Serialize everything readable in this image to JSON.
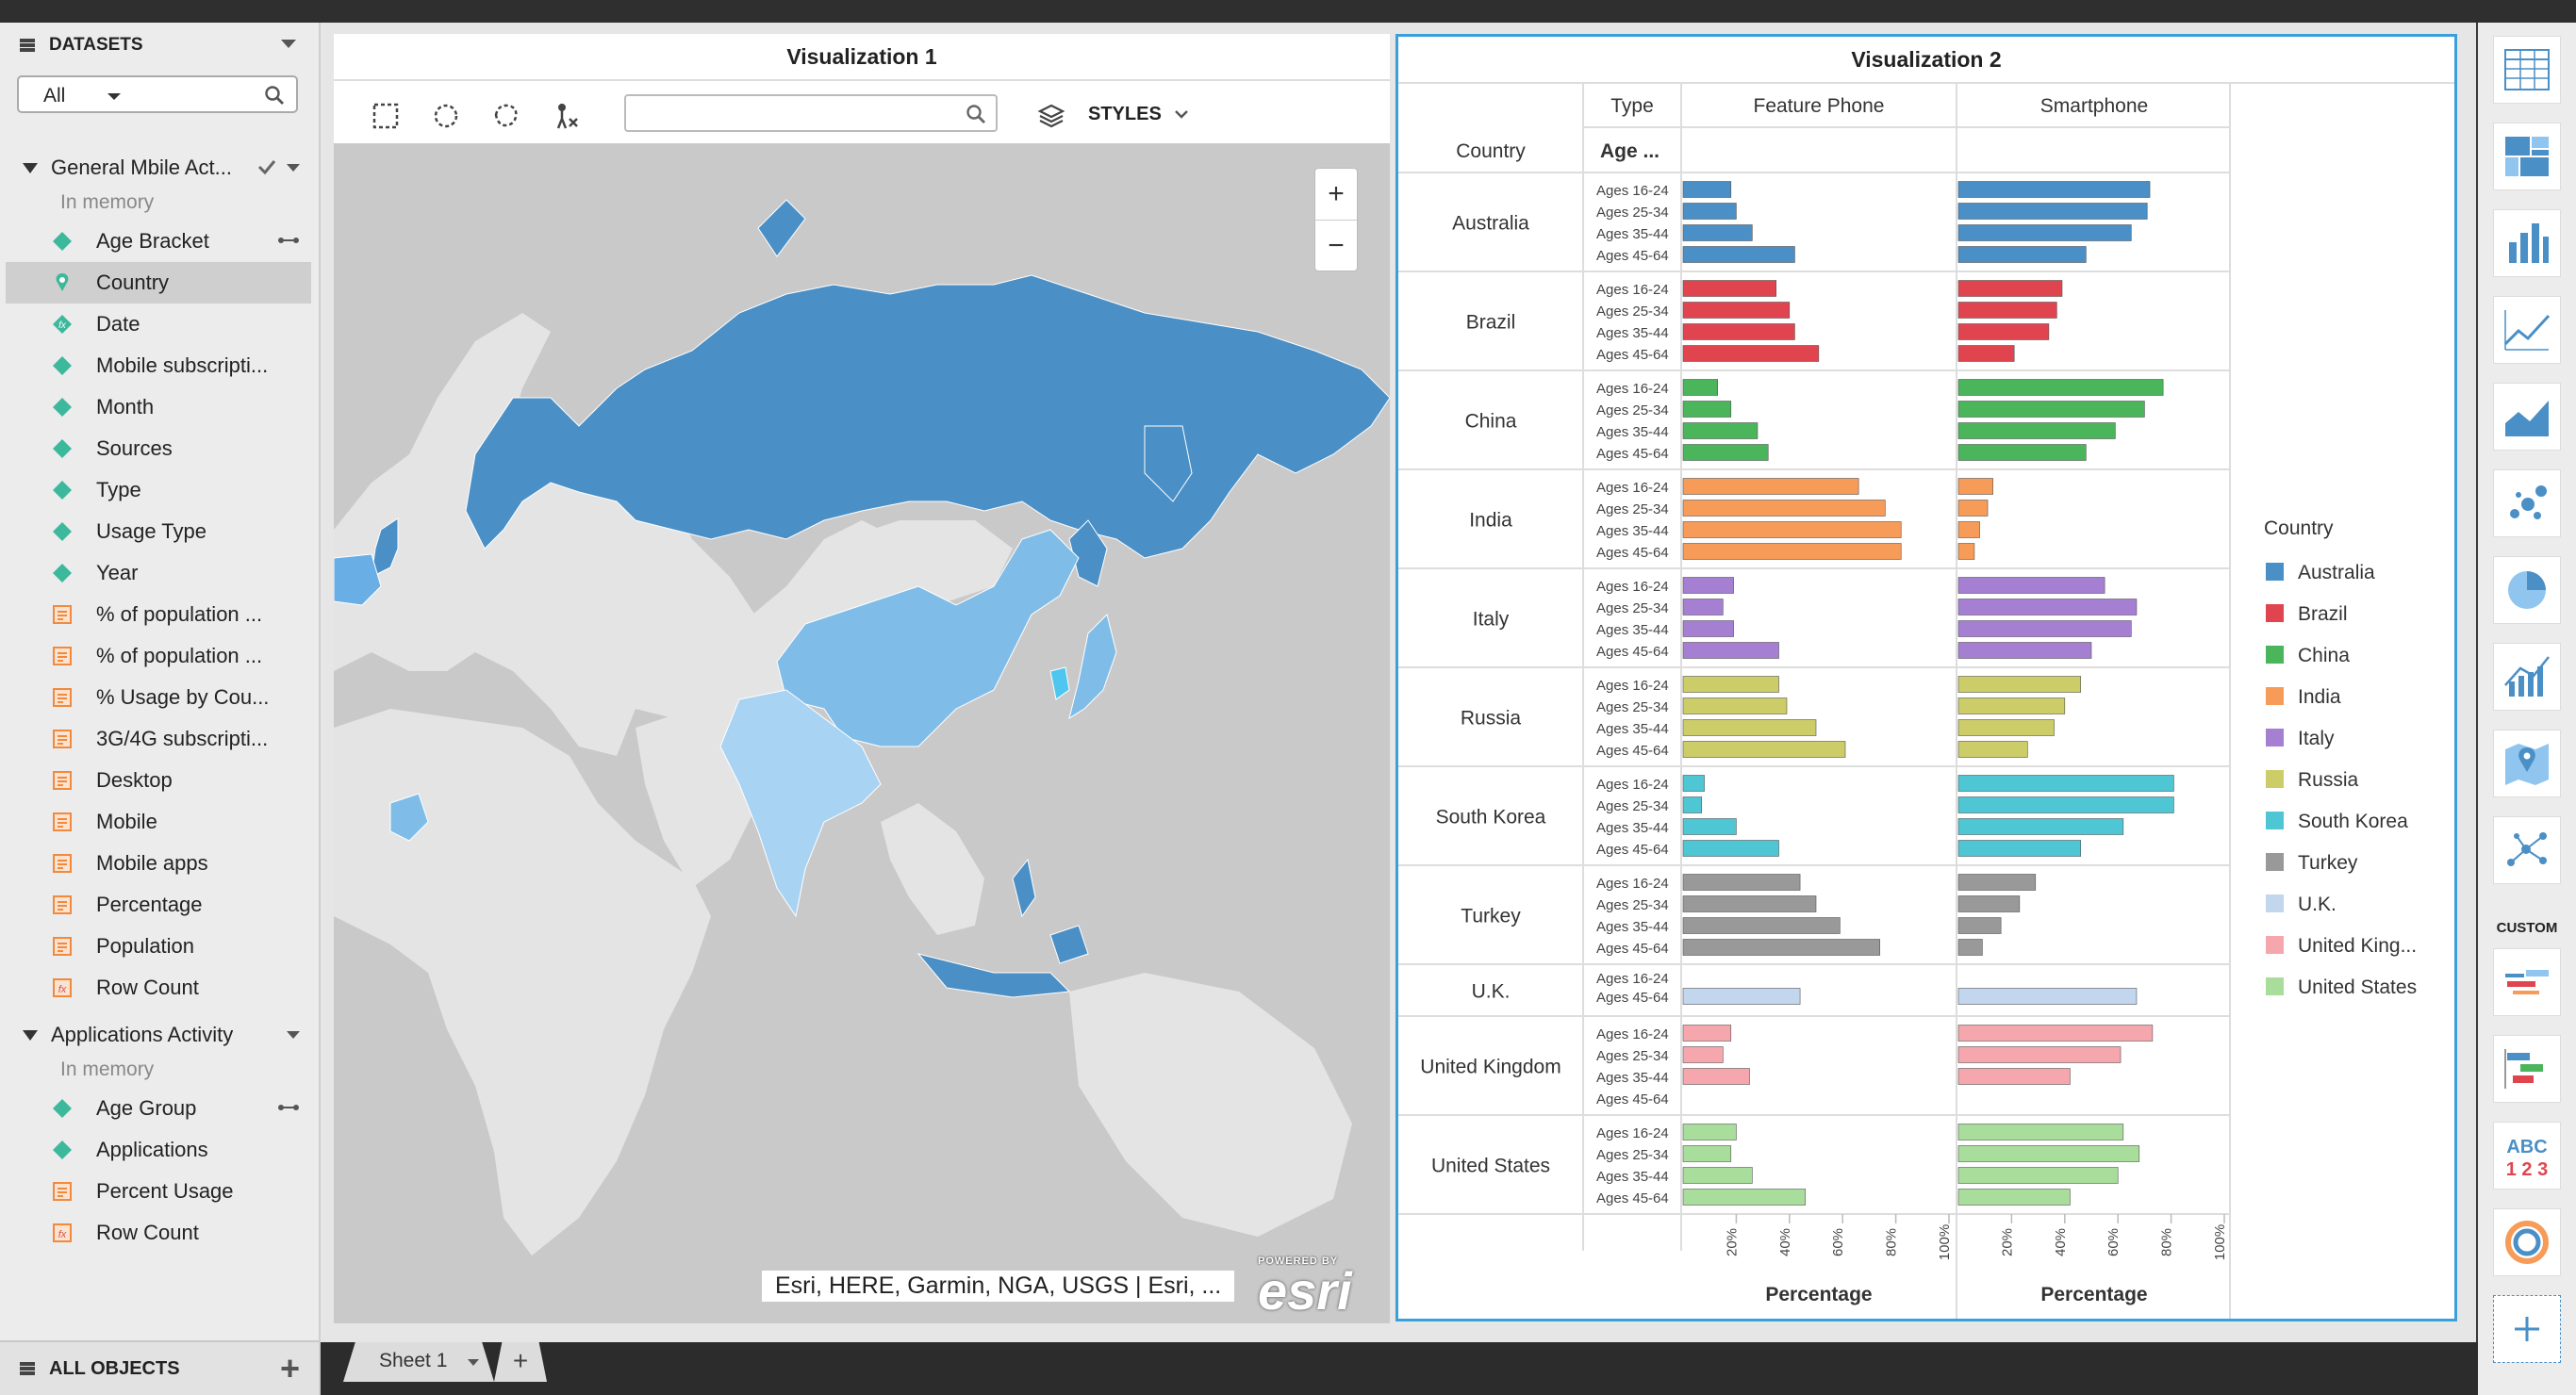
{
  "datasets_panel": {
    "title": "DATASETS",
    "filter_value": "All",
    "groups": [
      {
        "label": "General Mbile Act...",
        "status": "In memory",
        "items": [
          {
            "label": "Age Bracket",
            "icon": "attribute-icon"
          },
          {
            "label": "Country",
            "icon": "geo-attribute-icon"
          },
          {
            "label": "Date",
            "icon": "derived-attribute-icon"
          },
          {
            "label": "Mobile subscripti...",
            "icon": "attribute-icon"
          },
          {
            "label": "Month",
            "icon": "attribute-icon"
          },
          {
            "label": "Sources",
            "icon": "attribute-icon"
          },
          {
            "label": "Type",
            "icon": "attribute-icon"
          },
          {
            "label": "Usage Type",
            "icon": "attribute-icon"
          },
          {
            "label": "Year",
            "icon": "attribute-icon"
          },
          {
            "label": "% of population ...",
            "icon": "metric-icon"
          },
          {
            "label": "% of population ...",
            "icon": "metric-icon"
          },
          {
            "label": "% Usage by Cou...",
            "icon": "metric-icon"
          },
          {
            "label": "3G/4G subscripti...",
            "icon": "metric-icon"
          },
          {
            "label": "Desktop",
            "icon": "metric-icon"
          },
          {
            "label": "Mobile",
            "icon": "metric-icon"
          },
          {
            "label": "Mobile apps",
            "icon": "metric-icon"
          },
          {
            "label": "Percentage",
            "icon": "metric-icon"
          },
          {
            "label": "Population",
            "icon": "metric-icon"
          },
          {
            "label": "Row Count",
            "icon": "derived-metric-icon"
          }
        ]
      },
      {
        "label": "Applications Activity ...",
        "status": "In memory",
        "items": [
          {
            "label": "Age Group",
            "icon": "attribute-icon"
          },
          {
            "label": "Applications",
            "icon": "attribute-icon"
          },
          {
            "label": "Percent Usage",
            "icon": "metric-icon"
          },
          {
            "label": "Row Count",
            "icon": "derived-metric-icon"
          }
        ]
      }
    ],
    "all_objects_label": "ALL OBJECTS"
  },
  "viz1": {
    "title": "Visualization 1",
    "styles_label": "STYLES",
    "attribution": "Esri, HERE, Garmin, NGA, USGS | Esri, ...",
    "powered_by": "POWERED BY",
    "esri_logo": "esri",
    "zoom_in": "+",
    "zoom_out": "−"
  },
  "viz2": {
    "title": "Visualization 2",
    "header_type": "Type",
    "header_country": "Country",
    "header_age": "Age ...",
    "columns": [
      "Feature Phone",
      "Smartphone"
    ],
    "axis_title": "Percentage",
    "ticks": [
      "20%",
      "40%",
      "60%",
      "80%",
      "100%"
    ],
    "legend_title": "Country"
  },
  "chart_data": {
    "type": "bar",
    "orientation": "horizontal",
    "xlabel": "Percentage",
    "xlim": [
      0,
      100
    ],
    "panels": [
      "Feature Phone",
      "Smartphone"
    ],
    "countries": [
      {
        "name": "Australia",
        "legend": "Australia",
        "color": "#4a8fc6",
        "ages": [
          "Ages 16-24",
          "Ages 25-34",
          "Ages 35-44",
          "Ages 45-64"
        ],
        "feature": [
          18,
          20,
          26,
          42
        ],
        "smart": [
          72,
          71,
          65,
          48
        ]
      },
      {
        "name": "Brazil",
        "legend": "Brazil",
        "color": "#e0454f",
        "ages": [
          "Ages 16-24",
          "Ages 25-34",
          "Ages 35-44",
          "Ages 45-64"
        ],
        "feature": [
          35,
          40,
          42,
          51
        ],
        "smart": [
          39,
          37,
          34,
          21
        ]
      },
      {
        "name": "China",
        "legend": "China",
        "color": "#4bb55c",
        "ages": [
          "Ages 16-24",
          "Ages 25-34",
          "Ages 35-44",
          "Ages 45-64"
        ],
        "feature": [
          13,
          18,
          28,
          32
        ],
        "smart": [
          77,
          70,
          59,
          48
        ]
      },
      {
        "name": "India",
        "legend": "India",
        "color": "#f79b58",
        "ages": [
          "Ages 16-24",
          "Ages 25-34",
          "Ages 35-44",
          "Ages 45-64"
        ],
        "feature": [
          66,
          76,
          82,
          82
        ],
        "smart": [
          13,
          11,
          8,
          6
        ]
      },
      {
        "name": "Italy",
        "legend": "Italy",
        "color": "#a57fd2",
        "ages": [
          "Ages 16-24",
          "Ages 25-34",
          "Ages 35-44",
          "Ages 45-64"
        ],
        "feature": [
          19,
          15,
          19,
          36
        ],
        "smart": [
          55,
          67,
          65,
          50
        ]
      },
      {
        "name": "Russia",
        "legend": "Russia",
        "color": "#cccc68",
        "ages": [
          "Ages 16-24",
          "Ages 25-34",
          "Ages 35-44",
          "Ages 45-64"
        ],
        "feature": [
          36,
          39,
          50,
          61
        ],
        "smart": [
          46,
          40,
          36,
          26
        ]
      },
      {
        "name": "South Korea",
        "legend": "South Korea",
        "color": "#4ec6d4",
        "ages": [
          "Ages 16-24",
          "Ages 25-34",
          "Ages 35-44",
          "Ages 45-64"
        ],
        "feature": [
          8,
          7,
          20,
          36
        ],
        "smart": [
          81,
          81,
          62,
          46
        ]
      },
      {
        "name": "Turkey",
        "legend": "Turkey",
        "color": "#999999",
        "ages": [
          "Ages 16-24",
          "Ages 25-34",
          "Ages 35-44",
          "Ages 45-64"
        ],
        "feature": [
          44,
          50,
          59,
          74
        ],
        "smart": [
          29,
          23,
          16,
          9
        ]
      },
      {
        "name": "U.K.",
        "legend": "U.K.",
        "color": "#c2d6ee",
        "ages": [
          "Ages 16-24",
          "Ages 45-64"
        ],
        "feature": [
          null,
          44
        ],
        "smart": [
          null,
          67
        ]
      },
      {
        "name": "United Kingdom",
        "legend": "United King...",
        "color": "#f5a7ad",
        "ages": [
          "Ages 16-24",
          "Ages 25-34",
          "Ages 35-44",
          "Ages 45-64"
        ],
        "feature": [
          18,
          15,
          25,
          null
        ],
        "smart": [
          73,
          61,
          42,
          null
        ]
      },
      {
        "name": "United States",
        "legend": "United States",
        "color": "#a9dd9c",
        "ages": [
          "Ages 16-24",
          "Ages 25-34",
          "Ages 35-44",
          "Ages 45-64"
        ],
        "feature": [
          20,
          18,
          26,
          46
        ],
        "smart": [
          62,
          68,
          60,
          42
        ]
      }
    ]
  },
  "sheets": {
    "active": "Sheet 1",
    "add": "+"
  },
  "right_panel": {
    "custom_label": "CUSTOM",
    "tools": [
      "grid-icon",
      "heat-map-icon",
      "bar-chart-icon",
      "line-chart-icon",
      "area-chart-icon",
      "bubble-chart-icon",
      "pie-chart-icon",
      "combo-chart-icon",
      "map-icon",
      "network-icon"
    ],
    "custom_tools": [
      "word-cloud-icon",
      "gantt-icon",
      "kpi-icon",
      "sunburst-icon",
      "add-visualization-icon"
    ]
  }
}
